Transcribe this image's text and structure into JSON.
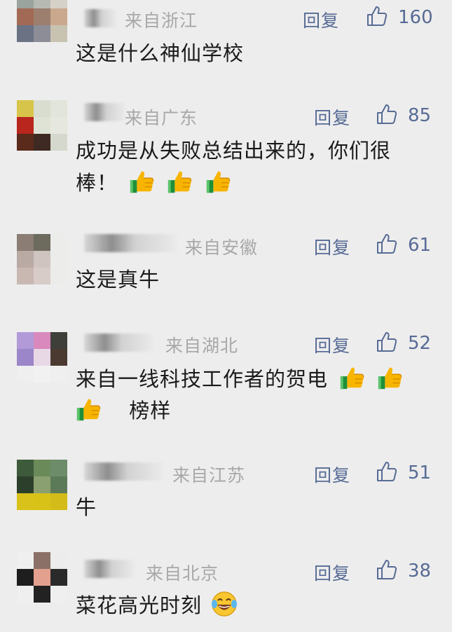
{
  "comments": [
    {
      "location": "来自浙江",
      "reply": "回复",
      "likes": "160",
      "lines": [
        "这是什么神仙学校"
      ]
    },
    {
      "location": "来自广东",
      "reply": "回复",
      "likes": "85",
      "lines": [
        "成功是从失败总结出来的，你们很",
        "棒！"
      ]
    },
    {
      "location": "来自安徽",
      "reply": "回复",
      "likes": "61",
      "lines": [
        "这是真牛"
      ]
    },
    {
      "location": "来自湖北",
      "reply": "回复",
      "likes": "52",
      "lines": [
        "来自一线科技工作者的贺电",
        "榜样"
      ]
    },
    {
      "location": "来自江苏",
      "reply": "回复",
      "likes": "51",
      "lines": [
        "牛"
      ]
    },
    {
      "location": "来自北京",
      "reply": "回复",
      "likes": "38",
      "lines": [
        "菜花高光时刻"
      ]
    }
  ],
  "icons": {
    "like": "thumbs-up-outline-icon",
    "emoji_thumb": "thumbs-up-emoji-icon",
    "emoji_laugh": "tears-of-joy-emoji-icon"
  },
  "colors": {
    "background": "#ededed",
    "link": "#576b95",
    "location": "#a8a8a8",
    "text": "#1a1a1a"
  }
}
